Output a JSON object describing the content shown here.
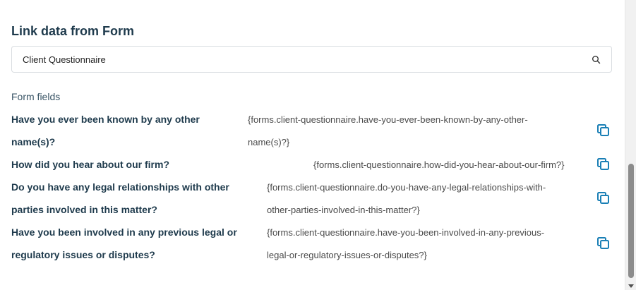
{
  "panel": {
    "title": "Link data from Form",
    "search": {
      "value": "Client Questionnaire"
    },
    "section_label": "Form fields"
  },
  "fields": [
    {
      "name_line1": "Have you ever been known by any other",
      "name_line2": "name(s)?",
      "tag_line1": "{forms.client-questionnaire.have-you-ever-been-known-by-any-other-",
      "tag_line2": "name(s)?}"
    },
    {
      "name_line1": "How did you hear about our firm?",
      "tag_line1": "{forms.client-questionnaire.how-did-you-hear-about-our-firm?}"
    },
    {
      "name_line1": "Do you have any legal relationships with other",
      "name_line2": "parties involved in this matter?",
      "tag_line1": "{forms.client-questionnaire.do-you-have-any-legal-relationships-with-",
      "tag_line2": "other-parties-involved-in-this-matter?}"
    },
    {
      "name_line1": "Have you been involved in any previous legal or",
      "name_line2": "regulatory issues or disputes?",
      "tag_line1": "{forms.client-questionnaire.have-you-been-involved-in-any-previous-",
      "tag_line2": "legal-or-regulatory-issues-or-disputes?}"
    }
  ],
  "icons": {
    "search": "search-icon",
    "copy": "copy-icon"
  },
  "colors": {
    "accent": "#1a7fb5",
    "heading": "#1e3a4c"
  }
}
